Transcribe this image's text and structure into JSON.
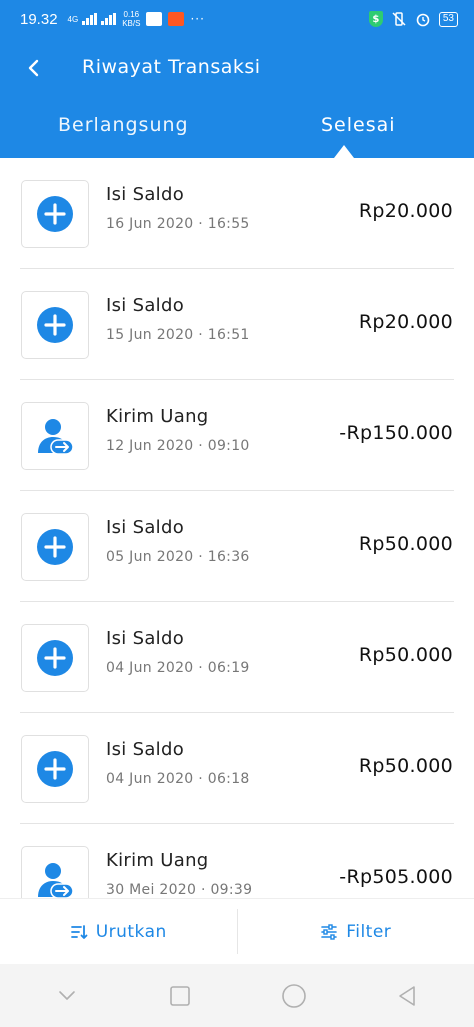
{
  "status_bar": {
    "time": "19.32",
    "network_type": "4G",
    "speed_value": "0.16",
    "speed_unit": "KB/S",
    "dots": "···",
    "battery": "53"
  },
  "app_bar": {
    "title": "Riwayat Transaksi",
    "tabs": [
      {
        "label": "Berlangsung",
        "active": false
      },
      {
        "label": "Selesai",
        "active": true
      }
    ]
  },
  "transactions": [
    {
      "type": "topup",
      "title": "Isi Saldo",
      "date": "16 Jun 2020 · 16:55",
      "amount": "Rp20.000"
    },
    {
      "type": "topup",
      "title": "Isi Saldo",
      "date": "15 Jun 2020 · 16:51",
      "amount": "Rp20.000"
    },
    {
      "type": "transfer",
      "title": "Kirim Uang",
      "date": "12 Jun 2020 · 09:10",
      "amount": "-Rp150.000"
    },
    {
      "type": "topup",
      "title": "Isi Saldo",
      "date": "05 Jun 2020 · 16:36",
      "amount": "Rp50.000"
    },
    {
      "type": "topup",
      "title": "Isi Saldo",
      "date": "04 Jun 2020 · 06:19",
      "amount": "Rp50.000"
    },
    {
      "type": "topup",
      "title": "Isi Saldo",
      "date": "04 Jun 2020 · 06:18",
      "amount": "Rp50.000"
    },
    {
      "type": "transfer",
      "title": "Kirim Uang",
      "date": "30 Mei 2020 · 09:39",
      "amount": "-Rp505.000"
    }
  ],
  "bottom_bar": {
    "sort_label": "Urutkan",
    "filter_label": "Filter"
  },
  "colors": {
    "primary": "#1e88e5",
    "icon_blue": "#1e88e5",
    "shield_green": "#2ecc71"
  }
}
